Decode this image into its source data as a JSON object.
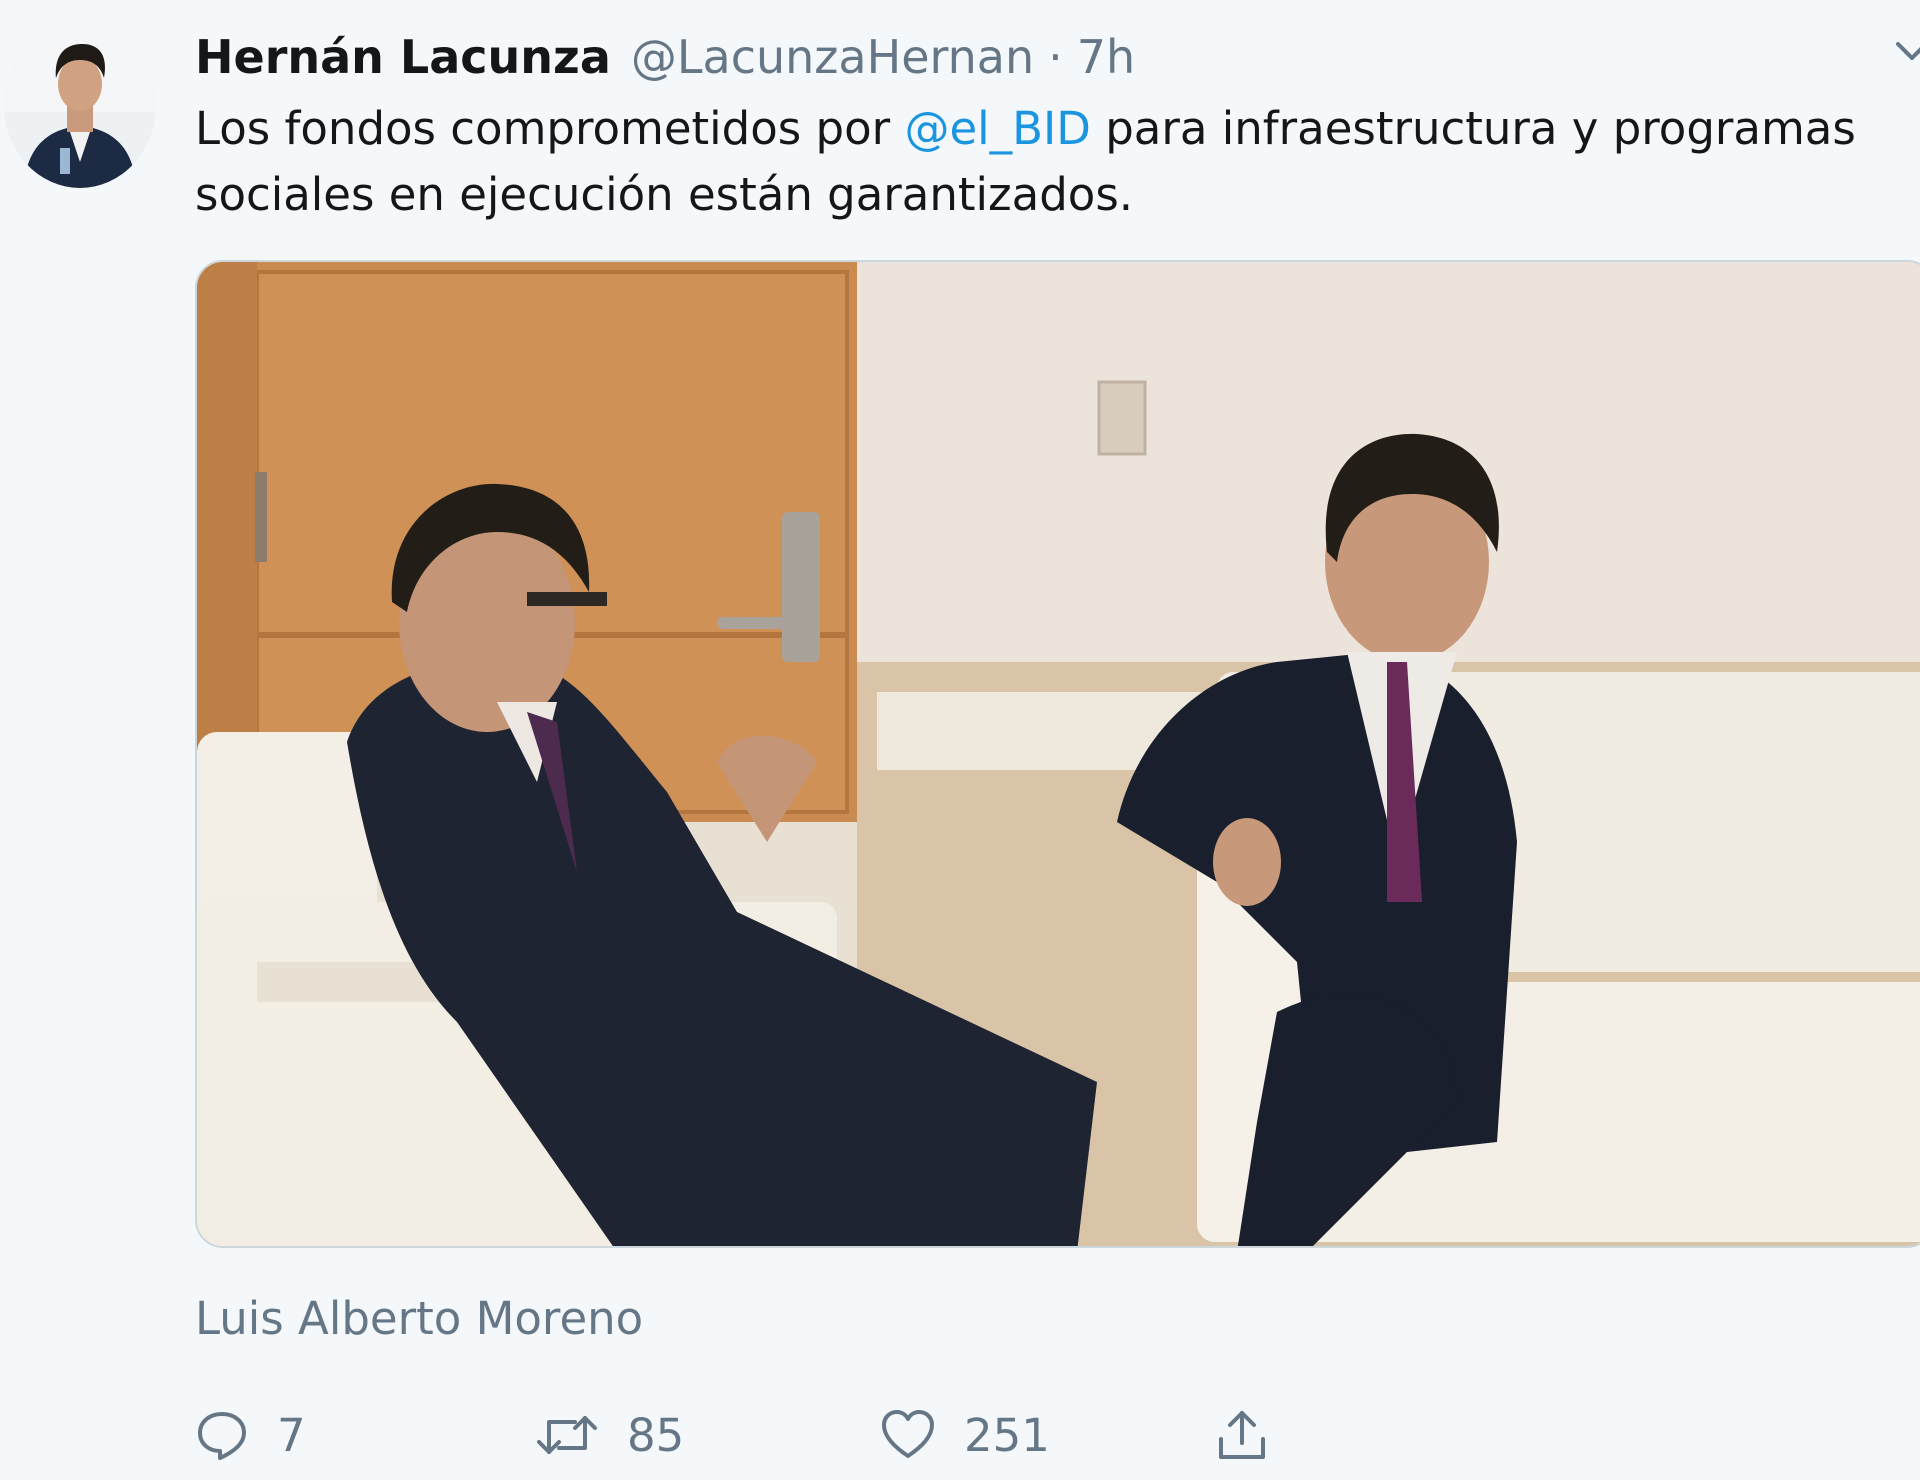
{
  "tweet": {
    "author_name": "Hernán Lacunza",
    "handle": "@LacunzaHernan",
    "separator": "·",
    "time": "7h",
    "text_before": "Los fondos comprometidos por ",
    "mention": "@el_BID",
    "text_after": " para infraestructura y programas sociales en ejecución están garantizados.",
    "tagged_person": "Luis Alberto Moreno",
    "replies": "7",
    "retweets": "85",
    "likes": "251"
  },
  "icons": {
    "reply": "speech-bubble-icon",
    "retweet": "retweet-arrows-icon",
    "like": "heart-icon",
    "share": "share-upload-icon",
    "menu": "chevron-down-icon"
  },
  "colors": {
    "link": "#1b95e0",
    "secondary": "#657786",
    "background": "#f5f8fa"
  }
}
